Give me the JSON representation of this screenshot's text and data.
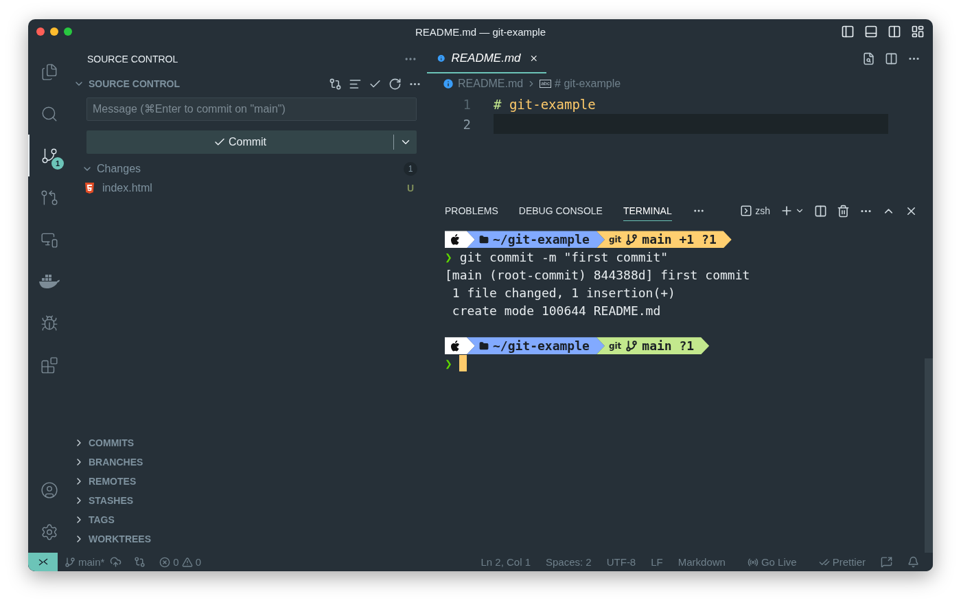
{
  "window": {
    "title": "README.md — git-example"
  },
  "activity_bar": {
    "items": [
      {
        "kind": "files",
        "selected": false
      },
      {
        "kind": "search",
        "selected": false
      },
      {
        "kind": "scm",
        "selected": true,
        "badge": "1"
      },
      {
        "kind": "graph",
        "selected": false
      },
      {
        "kind": "remote",
        "selected": false
      },
      {
        "kind": "docker",
        "selected": false
      },
      {
        "kind": "debug",
        "selected": false
      },
      {
        "kind": "extensions",
        "selected": false
      }
    ],
    "bottom_items": [
      {
        "kind": "account"
      },
      {
        "kind": "settings"
      }
    ]
  },
  "sidebar": {
    "title": "SOURCE CONTROL",
    "section": {
      "title": "SOURCE CONTROL",
      "expanded": true
    },
    "message": {
      "placeholder": "Message (⌘Enter to commit on \"main\")"
    },
    "commit_button": "Commit",
    "changes": {
      "label": "Changes",
      "count": "1",
      "expanded": true,
      "files": [
        {
          "name": "index.html",
          "status": "U"
        }
      ]
    },
    "collapsed_sections": [
      {
        "title": "COMMITS",
        "expanded": false
      },
      {
        "title": "BRANCHES",
        "expanded": false
      },
      {
        "title": "REMOTES",
        "expanded": false
      },
      {
        "title": "STASHES",
        "expanded": false
      },
      {
        "title": "TAGS",
        "expanded": false
      },
      {
        "title": "WORKTREES",
        "expanded": false
      }
    ]
  },
  "editor": {
    "tabs": [
      {
        "label": "README.md",
        "selected": true
      }
    ],
    "breadcrumb": [
      "README.md",
      "# git-example"
    ],
    "symbol_icon": "abc",
    "lines": [
      {
        "number": "1",
        "current": false,
        "tokens": [
          {
            "kind": "marker",
            "text": "#"
          },
          {
            "kind": "heading",
            "text": " git-example"
          }
        ]
      },
      {
        "number": "2",
        "current": true
      }
    ]
  },
  "panel": {
    "tabs": [
      {
        "label": "PROBLEMS",
        "selected": false
      },
      {
        "label": "DEBUG CONSOLE",
        "selected": false
      },
      {
        "label": "TERMINAL",
        "selected": true
      }
    ],
    "terminal_name": "zsh",
    "lines": [
      {
        "kind": "prompt",
        "path": "~/git-example",
        "git": "git",
        "branch": "main +1 ?1",
        "color": "#ffcf70"
      },
      {
        "kind": "command",
        "prompt_char": "❯",
        "text": "git commit -m \"first commit\""
      },
      {
        "kind": "output",
        "text": "[main (root-commit) 844388d] first commit"
      },
      {
        "kind": "output",
        "text": " 1 file changed, 1 insertion(+)"
      },
      {
        "kind": "output",
        "text": " create mode 100644 README.md"
      },
      {
        "kind": "gap"
      },
      {
        "kind": "prompt",
        "path": "~/git-example",
        "git": "git",
        "branch": "main ?1",
        "color": "#c3e88d"
      },
      {
        "kind": "cursor",
        "prompt_char": "❯"
      }
    ]
  },
  "status_bar": {
    "branch": "main*",
    "errors": "0",
    "warnings": "0",
    "right": [
      {
        "kind": "text",
        "text": "Ln 2, Col 1"
      },
      {
        "kind": "text",
        "text": "Spaces: 2"
      },
      {
        "kind": "text",
        "text": "UTF-8"
      },
      {
        "kind": "text",
        "text": "LF"
      },
      {
        "kind": "text",
        "text": "Markdown"
      },
      {
        "kind": "live",
        "text": "Go Live"
      },
      {
        "kind": "prettier",
        "text": "Prettier"
      },
      {
        "kind": "feedback"
      },
      {
        "kind": "bell"
      }
    ]
  }
}
